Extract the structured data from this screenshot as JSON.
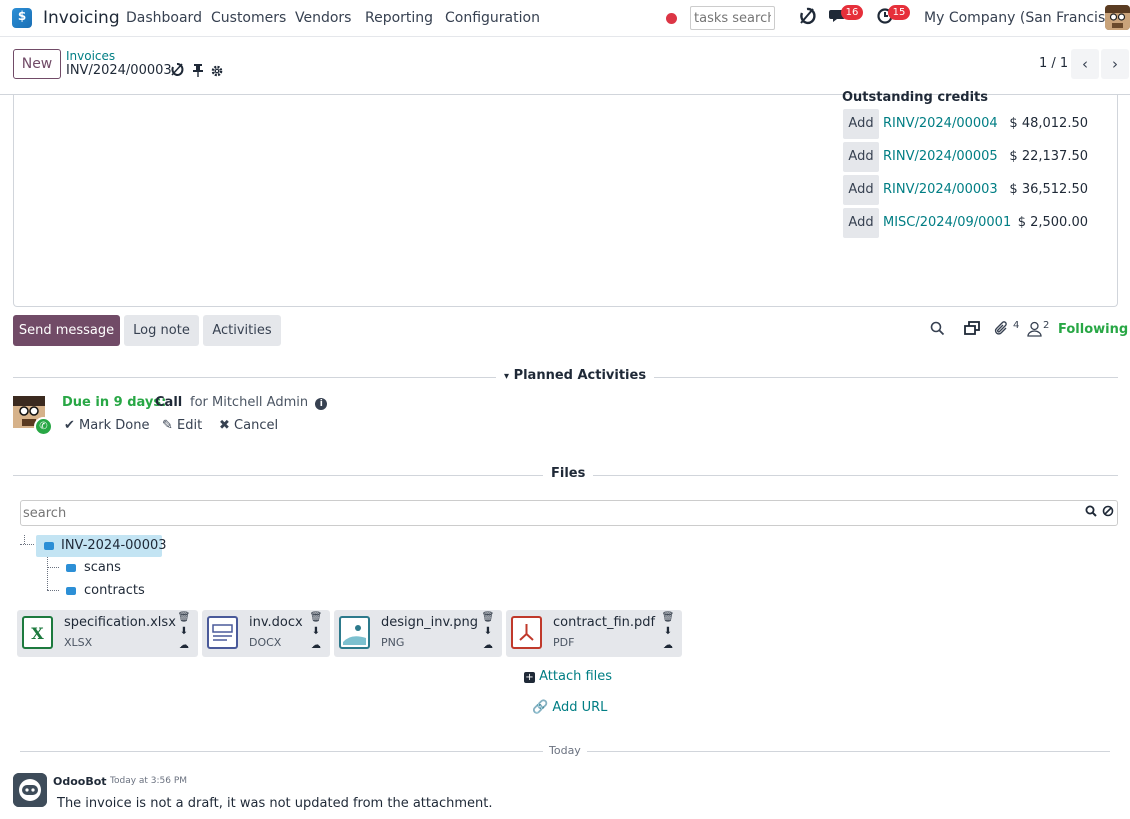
{
  "navbar": {
    "app_name": "Invoicing",
    "menu": [
      "Dashboard",
      "Customers",
      "Vendors",
      "Reporting",
      "Configuration"
    ],
    "tasks_search_placeholder": "tasks search",
    "messages_count": "16",
    "activities_count": "15",
    "company": "My Company (San Francisco)"
  },
  "control": {
    "new_label": "New",
    "breadcrumb_parent": "Invoices",
    "breadcrumb_current": "INV/2024/00003",
    "pager": "1 / 1"
  },
  "sheet": {
    "outstanding_title": "Outstanding credits",
    "add_label": "Add",
    "credits": [
      {
        "ref": "RINV/2024/00004",
        "amount": "$ 48,012.50"
      },
      {
        "ref": "RINV/2024/00005",
        "amount": "$ 22,137.50"
      },
      {
        "ref": "RINV/2024/00003",
        "amount": "$ 36,512.50"
      },
      {
        "ref": "MISC/2024/09/0001",
        "amount": "$ 2,500.00"
      }
    ]
  },
  "chatter": {
    "send_message": "Send message",
    "log_note": "Log note",
    "activities": "Activities",
    "attachments_count": "4",
    "followers_count": "2",
    "following": "Following"
  },
  "planned": {
    "title": "Planned Activities",
    "due": "Due in 9 days:",
    "type": "Call",
    "for": "for Mitchell Admin",
    "mark_done": "Mark Done",
    "edit": "Edit",
    "cancel": "Cancel"
  },
  "files": {
    "title": "Files",
    "search_placeholder": "search",
    "root": "INV-2024-00003",
    "children": [
      "scans",
      "contracts"
    ],
    "items": [
      {
        "name": "specification.xlsx",
        "ext": "XLSX"
      },
      {
        "name": "inv.docx",
        "ext": "DOCX"
      },
      {
        "name": "design_inv.png",
        "ext": "PNG"
      },
      {
        "name": "contract_fin.pdf",
        "ext": "PDF"
      }
    ],
    "attach_files": "Attach files",
    "add_url": "Add URL"
  },
  "thread": {
    "day": "Today",
    "author": "OdooBot",
    "time": "Today at 3:56 PM",
    "message": "The invoice is not a draft, it was not updated from the attachment."
  }
}
